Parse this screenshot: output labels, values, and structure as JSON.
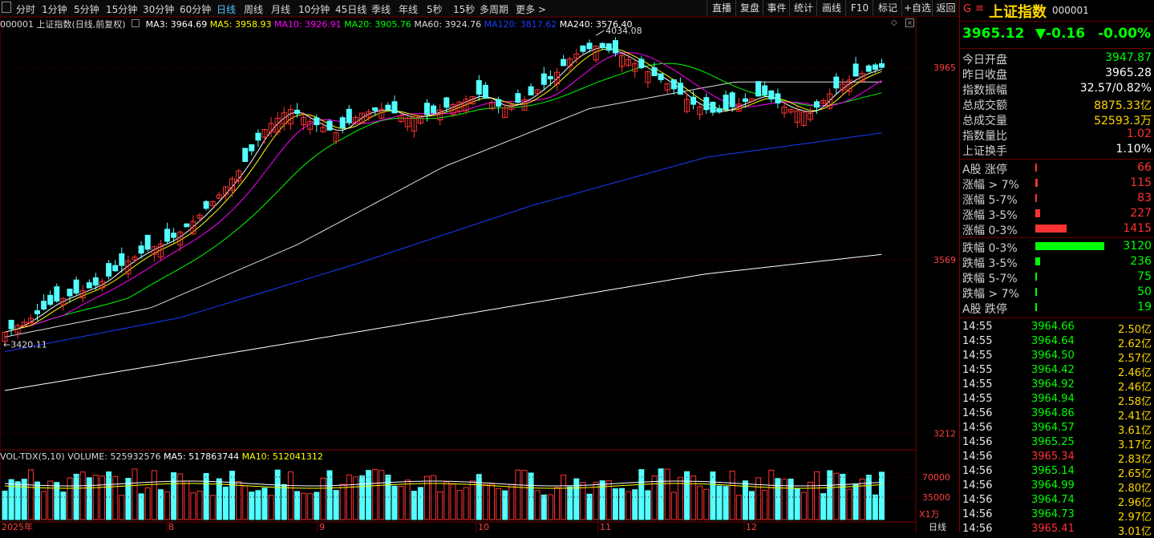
{
  "toolbar": {
    "left_items": [
      "分时",
      "1分钟",
      "5分钟",
      "15分钟",
      "30分钟",
      "60分钟",
      "日线",
      "周线",
      "月线",
      "10分钟",
      "45日线",
      "季线",
      "年线",
      "5秒",
      "15秒",
      "多周期",
      "更多 >"
    ],
    "active_item": "日线",
    "right_items": [
      "直播",
      "复盘",
      "事件",
      "统计",
      "画线",
      "F10",
      "标记",
      "+自选",
      "返回"
    ]
  },
  "chart_header": {
    "title": "000001 上证指数(日线,前复权)",
    "ma": [
      {
        "label": "MA3: 3964.69",
        "color": "#ffffff"
      },
      {
        "label": "MA5: 3958.93",
        "color": "#ffff00"
      },
      {
        "label": "MA10: 3926.91",
        "color": "#ff00ff"
      },
      {
        "label": "MA20: 3905.76",
        "color": "#00ff00"
      },
      {
        "label": "MA60: 3924.76",
        "color": "#dddddd"
      },
      {
        "label": "MA120: 3817.62",
        "color": "#1a3cff"
      },
      {
        "label": "MA240: 3576.40",
        "color": "#ffffff"
      }
    ]
  },
  "chart_data": {
    "type": "candlestick",
    "price_axis_ticks": [
      "3965",
      "3569",
      "3212"
    ],
    "annotations": {
      "high": "4034.08",
      "low": "3420.11"
    },
    "volume_header": {
      "label": "VOL-TDX(5,10)",
      "volume": "VOLUME: 525932576",
      "ma5": "MA5: 517863744",
      "ma10": "MA10: 512041312"
    },
    "volume_axis_ticks": [
      "70000",
      "35000"
    ],
    "volume_unit": "X1万",
    "date_labels": [
      "2025年",
      "8",
      "9",
      "10",
      "11",
      "12"
    ],
    "period_label": "日线",
    "colors": {
      "up": "#ff3232",
      "down": "#54ffff",
      "ma3": "#ffffff",
      "ma5": "#ffff00",
      "ma10": "#ff00ff",
      "ma20": "#00ff00",
      "ma60": "#dddddd",
      "ma120": "#1a3cff",
      "ma240": "#ffffff"
    }
  },
  "sidebar": {
    "logo": "G",
    "menu_icon": "≡",
    "name": "上证指数",
    "code": "000001",
    "price": "3965.12",
    "change": "▼-0.16",
    "change_pct": "-0.00%",
    "stats": [
      {
        "label": "今日开盘",
        "value": "3947.87",
        "color": "#00ff00"
      },
      {
        "label": "昨日收盘",
        "value": "3965.28",
        "color": "#ffffff"
      },
      {
        "label": "指数振幅",
        "value": "32.57/0.82%",
        "color": "#ffffff"
      },
      {
        "label": "总成交额",
        "value": "8875.33亿",
        "color": "#ffd700"
      },
      {
        "label": "总成交量",
        "value": "52593.3万",
        "color": "#ffd700"
      },
      {
        "label": "指数量比",
        "value": "1.02",
        "color": "#ff3232"
      },
      {
        "label": "上证换手",
        "value": "1.10%",
        "color": "#ffffff"
      }
    ],
    "distribution": [
      {
        "label": "A股 涨停",
        "value": "66",
        "color": "#ff3232",
        "bar": 0.01
      },
      {
        "label": "涨幅 > 7%",
        "value": "115",
        "color": "#ff3232",
        "bar": 0.03
      },
      {
        "label": "涨幅 5-7%",
        "value": "83",
        "color": "#ff3232",
        "bar": 0.025
      },
      {
        "label": "涨幅 3-5%",
        "value": "227",
        "color": "#ff3232",
        "bar": 0.07
      },
      {
        "label": "涨幅 0-3%",
        "value": "1415",
        "color": "#ff3232",
        "bar": 0.45
      },
      {
        "label": "跌幅 0-3%",
        "value": "3120",
        "color": "#00ff00",
        "bar": 1.0
      },
      {
        "label": "跌幅 3-5%",
        "value": "236",
        "color": "#00ff00",
        "bar": 0.075
      },
      {
        "label": "跌幅 5-7%",
        "value": "75",
        "color": "#00ff00",
        "bar": 0.024
      },
      {
        "label": "跌幅 > 7%",
        "value": "50",
        "color": "#00ff00",
        "bar": 0.016
      },
      {
        "label": "A股 跌停",
        "value": "19",
        "color": "#00ff00",
        "bar": 0.006
      }
    ],
    "ticks": [
      {
        "time": "14:55",
        "price": "3964.66",
        "color": "#00ff00",
        "vol": "2.50亿"
      },
      {
        "time": "14:55",
        "price": "3964.64",
        "color": "#00ff00",
        "vol": "2.62亿"
      },
      {
        "time": "14:55",
        "price": "3964.50",
        "color": "#00ff00",
        "vol": "2.57亿"
      },
      {
        "time": "14:55",
        "price": "3964.42",
        "color": "#00ff00",
        "vol": "2.46亿"
      },
      {
        "time": "14:55",
        "price": "3964.92",
        "color": "#00ff00",
        "vol": "2.46亿"
      },
      {
        "time": "14:55",
        "price": "3964.94",
        "color": "#00ff00",
        "vol": "2.58亿"
      },
      {
        "time": "14:56",
        "price": "3964.86",
        "color": "#00ff00",
        "vol": "2.41亿"
      },
      {
        "time": "14:56",
        "price": "3964.57",
        "color": "#00ff00",
        "vol": "3.61亿"
      },
      {
        "time": "14:56",
        "price": "3965.25",
        "color": "#00ff00",
        "vol": "3.17亿"
      },
      {
        "time": "14:56",
        "price": "3965.34",
        "color": "#ff3232",
        "vol": "2.83亿"
      },
      {
        "time": "14:56",
        "price": "3965.14",
        "color": "#00ff00",
        "vol": "2.65亿"
      },
      {
        "time": "14:56",
        "price": "3964.99",
        "color": "#00ff00",
        "vol": "2.80亿"
      },
      {
        "time": "14:56",
        "price": "3964.74",
        "color": "#00ff00",
        "vol": "2.96亿"
      },
      {
        "time": "14:56",
        "price": "3964.73",
        "color": "#00ff00",
        "vol": "2.97亿"
      },
      {
        "time": "14:56",
        "price": "3965.41",
        "color": "#ff3232",
        "vol": "3.01亿"
      }
    ]
  }
}
